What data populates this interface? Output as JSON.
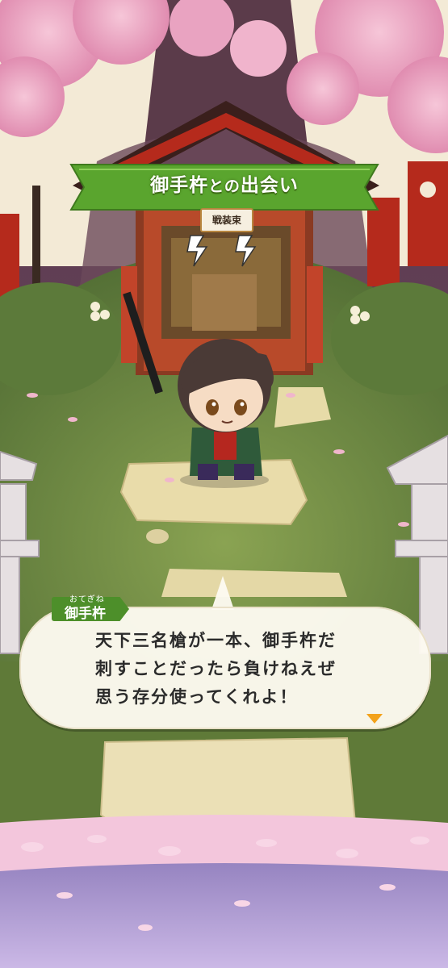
{
  "banner": {
    "name": "御手杵",
    "connector": "との",
    "suffix": "出会い"
  },
  "shrine": {
    "plaque": "戦装束"
  },
  "dialogue": {
    "speaker": "御手杵",
    "speaker_ruby": "おてぎね",
    "lines": [
      "天下三名槍が一本、御手杵だ",
      "刺すことだったら負けねえぜ",
      "思う存分使ってくれよ！"
    ]
  },
  "colors": {
    "banner_green": "#5aa52e",
    "name_tag_green": "#4d8f2a",
    "shrine_red": "#b52a1c",
    "next_arrow": "#f3a21b"
  },
  "icons": {
    "next": "triangle-down-icon"
  }
}
